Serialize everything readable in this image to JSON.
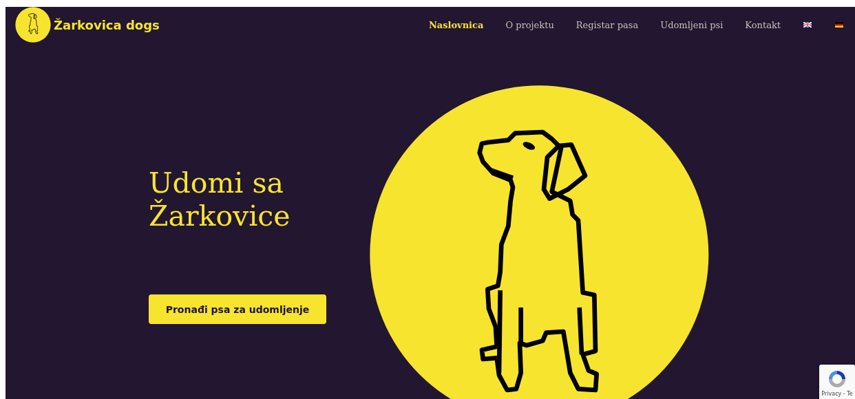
{
  "header": {
    "logo_text": "Žarkovica dogs",
    "nav": [
      {
        "label": "Naslovnica",
        "selected": true
      },
      {
        "label": "O projektu",
        "selected": false
      },
      {
        "label": "Registar pasa",
        "selected": false
      },
      {
        "label": "Udomljeni psi",
        "selected": false
      },
      {
        "label": "Kontakt",
        "selected": false
      }
    ],
    "languages": [
      {
        "kind": "uk"
      },
      {
        "kind": "de"
      }
    ]
  },
  "hero": {
    "title": "Udomi sa Žarkovice",
    "button": "Pronađi psa za udomljenje"
  },
  "recaptcha": {
    "text": "Privacy - Te"
  }
}
